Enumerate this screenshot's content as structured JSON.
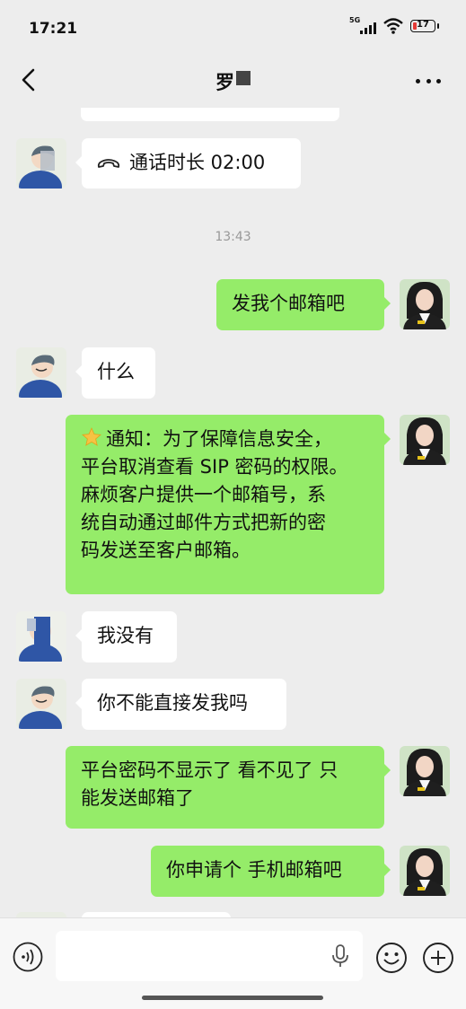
{
  "status_bar": {
    "time": "17:21",
    "network": "5G",
    "battery": "17"
  },
  "header": {
    "title": "罗"
  },
  "messages": {
    "m1": "通话时长 02:00",
    "time1": "13:43",
    "m2": "发我个邮箱吧",
    "m3": "什么",
    "m4_line1": "通知：为了保障信息安全，",
    "m4_line2": "平台取消查看 SIP 密码的权限。",
    "m4_line3": "麻烦客户提供一个邮箱号，系",
    "m4_line4": "统自动通过邮件方式把新的密",
    "m4_line5": "码发送至客户邮箱。",
    "m5": "我没有",
    "m6": "你不能直接发我吗",
    "m7_line1": "平台密码不显示了 看不见了 只",
    "m7_line2": "能发送邮箱了",
    "m8": "你申请个 手机邮箱吧"
  },
  "input": {
    "value": "",
    "placeholder": ""
  },
  "icons": {
    "back": "chevron-left-icon",
    "more": "more-dots-icon",
    "call": "phone-hangup-icon",
    "star": "star-icon",
    "voice": "voice-icon",
    "mic": "microphone-icon",
    "emoji": "emoji-icon",
    "plus": "plus-icon"
  },
  "colors": {
    "background": "#ededed",
    "bubble_sent": "#95ec69",
    "bubble_received": "#ffffff",
    "battery_low": "#e53935"
  }
}
